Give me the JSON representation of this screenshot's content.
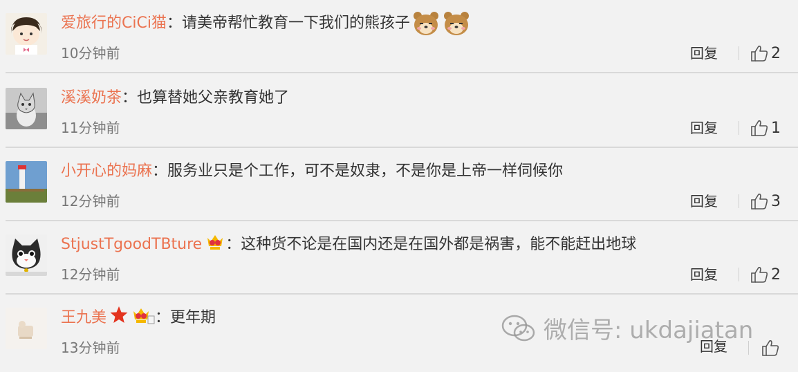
{
  "comments": [
    {
      "user": "爱旅行的CiCi猫",
      "colon": "：",
      "text": "请美帝帮忙教育一下我们的熊孩子",
      "time": "10分钟前",
      "reply": "回复",
      "likes": "2"
    },
    {
      "user": "溪溪奶茶",
      "colon": "：",
      "text": "也算替她父亲教育她了",
      "time": "11分钟前",
      "reply": "回复",
      "likes": "1"
    },
    {
      "user": "小开心的妈麻",
      "colon": "：",
      "text": "服务业只是个工作，可不是奴隶，不是你是上帝一样伺候你",
      "time": "12分钟前",
      "reply": "回复",
      "likes": "3"
    },
    {
      "user": "StjustTgoodTBture",
      "colon": "：",
      "text": "这种货不论是在国内还是在国外都是祸害，能不能赶出地球",
      "time": "12分钟前",
      "reply": "回复",
      "likes": "2"
    },
    {
      "user": "王九美",
      "colon": "：",
      "text": "更年期",
      "time": "13分钟前",
      "reply": "回复",
      "likes": ""
    }
  ],
  "watermark": {
    "text": "微信号: ukdajiatan"
  },
  "colors": {
    "username": "#eb7350",
    "text": "#333333",
    "time": "#777777",
    "background": "#f2f2f2"
  },
  "icons": [
    "thumbs-up-icon",
    "vip-crown-icon",
    "star-icon",
    "bear-emoji-icon",
    "wechat-icon"
  ]
}
